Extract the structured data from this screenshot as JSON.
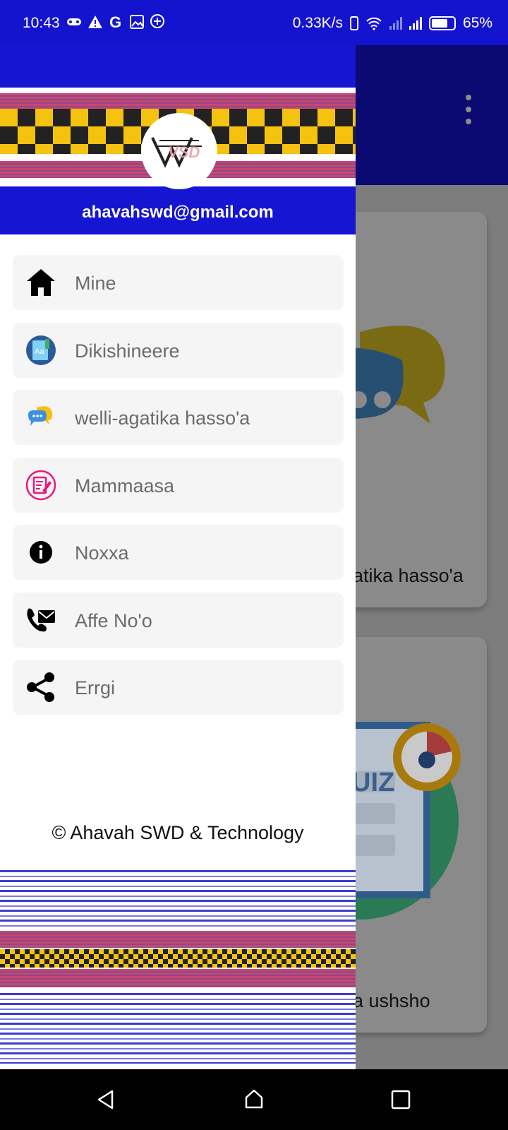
{
  "status_bar": {
    "time": "10:43",
    "net_speed": "0.33K/s",
    "battery": "65%",
    "icons": [
      "gamepad-icon",
      "warning-icon",
      "google-icon",
      "image-icon",
      "assistant-icon",
      "phone-icon",
      "wifi-icon",
      "signal-icon",
      "signal-icon",
      "battery-icon"
    ]
  },
  "background_app": {
    "card1_caption": "atika hasso'a",
    "card2_caption": "a ushsho",
    "card2_badge": "UIZ"
  },
  "drawer": {
    "email": "ahavahswd@gmail.com",
    "logo_text": "VSD",
    "menu": [
      {
        "label": "Mine",
        "icon": "home-icon"
      },
      {
        "label": "Dikishineere",
        "icon": "dictionary-icon"
      },
      {
        "label": "welli-agatika hasso'a",
        "icon": "chat-bubbles-icon"
      },
      {
        "label": "Mammaasa",
        "icon": "edit-note-icon"
      },
      {
        "label": "Noxxa",
        "icon": "info-icon"
      },
      {
        "label": "Affe No'o",
        "icon": "contact-icon"
      },
      {
        "label": "Errgi",
        "icon": "share-icon"
      }
    ],
    "copyright": "© Ahavah SWD & Technology"
  },
  "nav_bar": {
    "buttons": [
      "back-icon",
      "home-icon",
      "recents-icon"
    ]
  },
  "colors": {
    "primary": "#1515d2",
    "appbar_dimmed": "#0a0a72",
    "scrim": "#7d7d7d",
    "checker_yellow": "#f5c20f",
    "band_pink": "#c9466f"
  }
}
